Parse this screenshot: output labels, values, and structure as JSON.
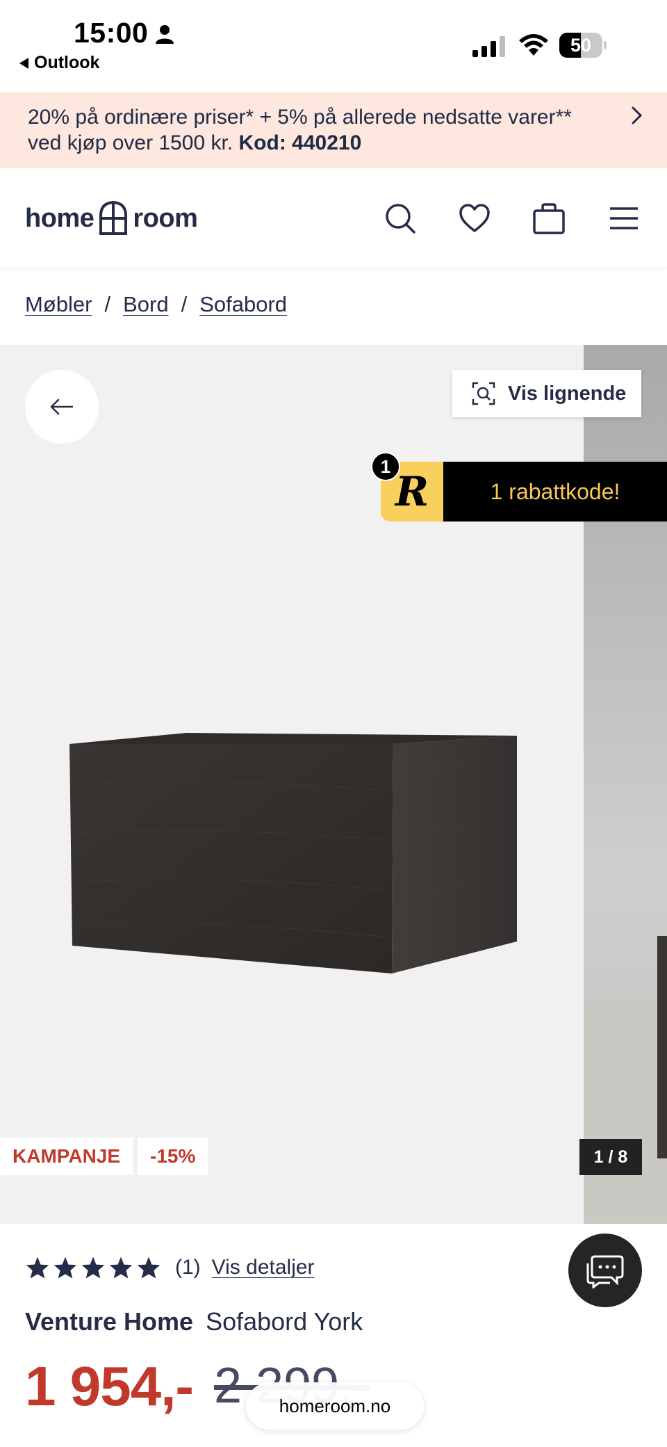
{
  "status_bar": {
    "time": "15:00",
    "back_app": "Outlook",
    "battery": "50",
    "battery_level": 0.5
  },
  "promo": {
    "text": "20% på ordinære priser* + 5% på allerede nedsatte varer** ved kjøp over 1500 kr.",
    "code_label": "Kod: 440210"
  },
  "header": {
    "logo_left": "home",
    "logo_right": "room",
    "icons": [
      "search-icon",
      "heart-icon",
      "bag-icon",
      "menu-icon"
    ]
  },
  "breadcrumb": {
    "items": [
      "Møbler",
      "Bord",
      "Sofabord"
    ],
    "separator": "/"
  },
  "gallery": {
    "similar_label": "Vis lignende",
    "discount_widget_count": "1",
    "discount_widget_logo": "R",
    "discount_widget_text": "1 rabattkode!",
    "badge_campaign": "KAMPANJE",
    "badge_discount": "-15%",
    "counter": "1 / 8"
  },
  "product": {
    "rating_stars": 5,
    "rating_count": "(1)",
    "details_link": "Vis detaljer",
    "brand": "Venture Home",
    "name": "Sofabord York",
    "price_now": "1 954,-",
    "price_old": "2 299,-"
  },
  "browser": {
    "url": "homeroom.no"
  },
  "colors": {
    "promo_bg": "#fde7df",
    "brand_navy": "#252c48",
    "sale_red": "#c0392b",
    "rabatt_yellow": "#f9cf5d"
  }
}
